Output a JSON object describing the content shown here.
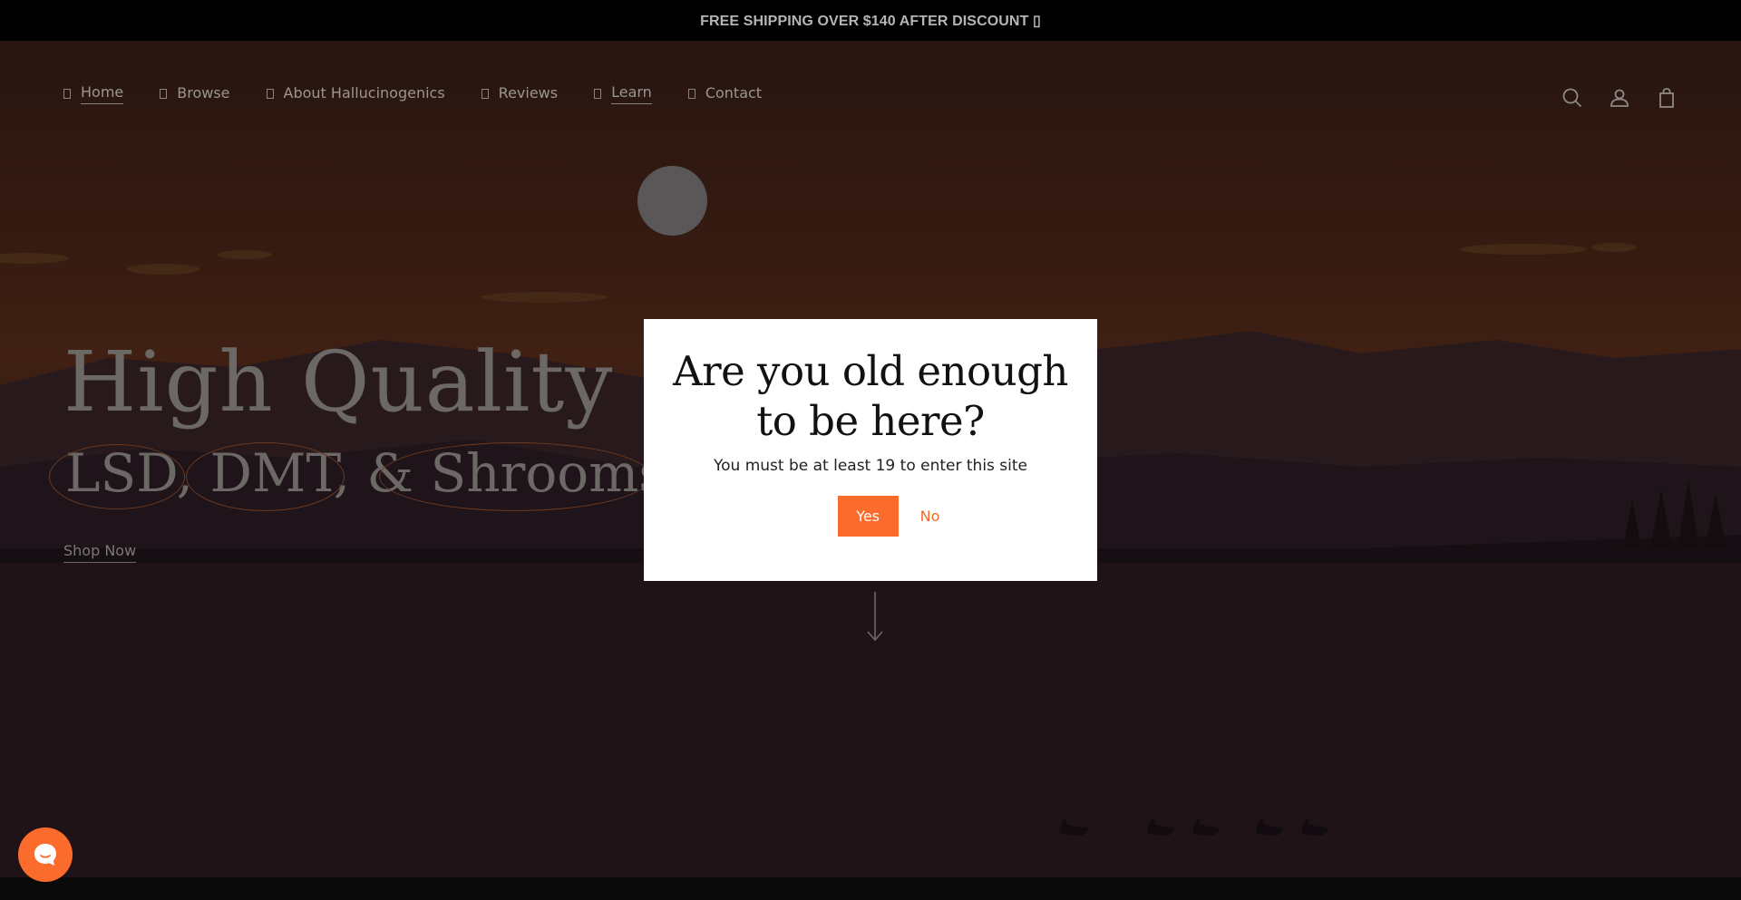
{
  "announcement": {
    "text": "FREE SHIPPING OVER $140 AFTER DISCOUNT ▯"
  },
  "nav": {
    "items": [
      {
        "label": "Home",
        "icon": "nav-glyph-icon",
        "underlined": true
      },
      {
        "label": "Browse",
        "icon": "nav-glyph-icon",
        "underlined": false
      },
      {
        "label": "About Hallucinogenics",
        "icon": "nav-glyph-icon",
        "underlined": false
      },
      {
        "label": "Reviews",
        "icon": "nav-glyph-icon",
        "underlined": false
      },
      {
        "label": "Learn",
        "icon": "nav-glyph-icon",
        "underlined": true
      },
      {
        "label": "Contact",
        "icon": "nav-glyph-icon",
        "underlined": false
      }
    ],
    "right_icons": [
      "search-icon",
      "account-icon",
      "cart-icon"
    ]
  },
  "hero": {
    "title": "High Quality",
    "subtitle": "LSD, DMT, & Shrooms.",
    "cta": "Shop Now",
    "scroll_icon": "arrow-down-icon"
  },
  "age_modal": {
    "heading_line1": "Are you old enough",
    "heading_line2": "to be here?",
    "message": "You must be at least 19 to enter this site",
    "yes_label": "Yes",
    "no_label": "No"
  },
  "colors": {
    "accent": "#fb6c2c",
    "announcement_bg": "#000000",
    "modal_bg": "#ffffff"
  },
  "chat": {
    "icon": "chat-bubble-icon"
  }
}
